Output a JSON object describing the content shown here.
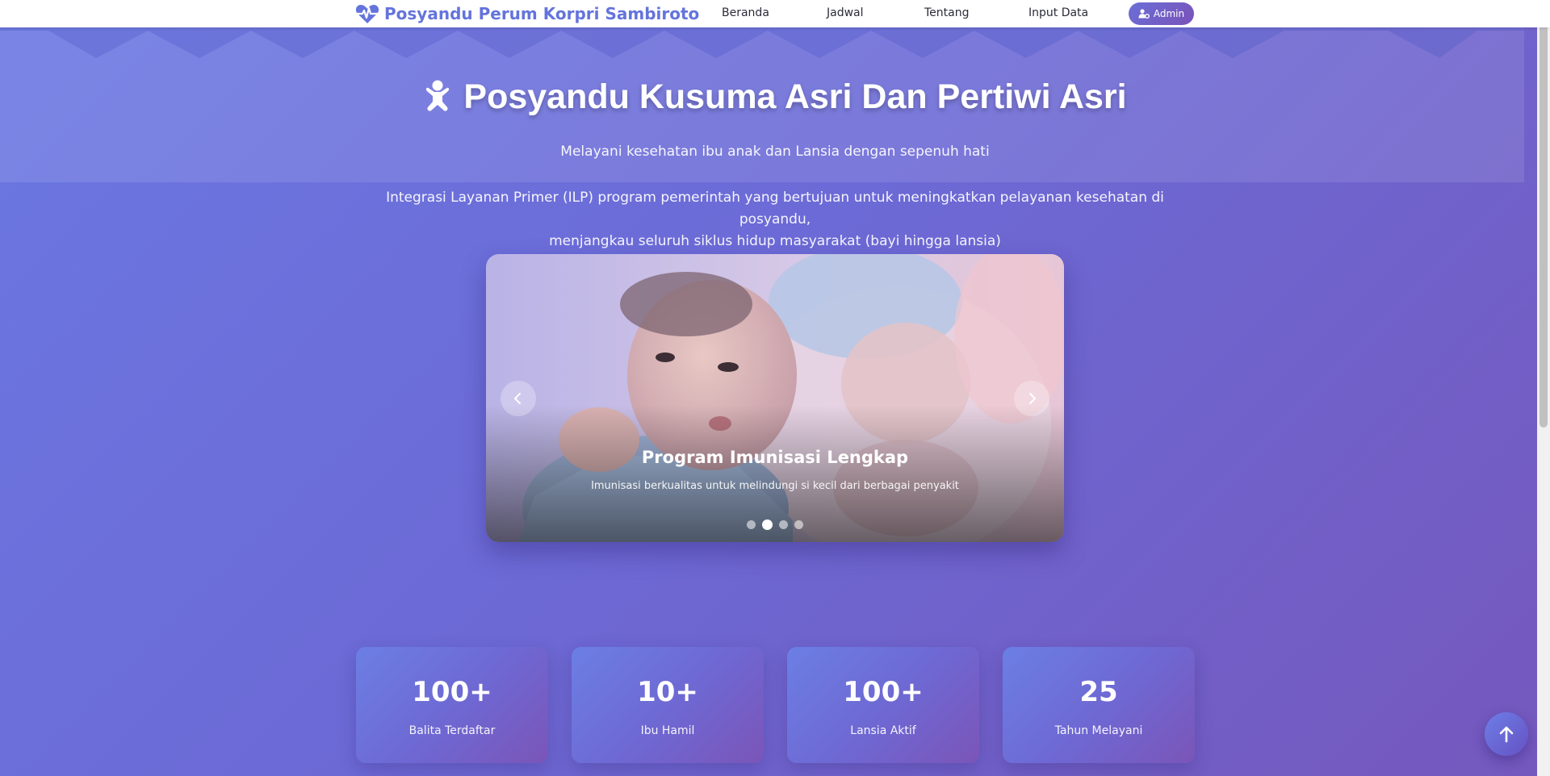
{
  "navbar": {
    "brand": "Posyandu Perum Korpri Sambiroto",
    "brand_icon": "heartbeat-icon",
    "links": [
      "Beranda",
      "Jadwal",
      "Tentang",
      "Input Data"
    ],
    "admin_label": "Admin",
    "admin_icon": "user-gear-icon"
  },
  "hero": {
    "title": "Posyandu Kusuma Asri Dan Pertiwi Asri",
    "title_icon": "baby-icon",
    "subtitle": "Melayani kesehatan ibu anak dan Lansia dengan sepenuh hati",
    "description_line1": "Integrasi Layanan Primer (ILP) program pemerintah yang bertujuan untuk meningkatkan pelayanan kesehatan di posyandu,",
    "description_line2": "menjangkau seluruh siklus hidup masyarakat (bayi hingga lansia)"
  },
  "carousel": {
    "slide_title": "Program Imunisasi Lengkap",
    "slide_caption": "Imunisasi berkualitas untuk melindungi si kecil dari berbagai penyakit",
    "total_slides": 4,
    "active_slide": 2,
    "prev_icon": "chevron-left-icon",
    "next_icon": "chevron-right-icon"
  },
  "stats": [
    {
      "value": "100+",
      "label": "Balita Terdaftar"
    },
    {
      "value": "10+",
      "label": "Ibu Hamil"
    },
    {
      "value": "100+",
      "label": "Lansia Aktif"
    },
    {
      "value": "25",
      "label": "Tahun Melayani"
    }
  ],
  "scroll_top_icon": "arrow-up-icon",
  "colors": {
    "brand": "#6474dc",
    "bg_start": "#6b78e2",
    "bg_end": "#7558bd"
  }
}
